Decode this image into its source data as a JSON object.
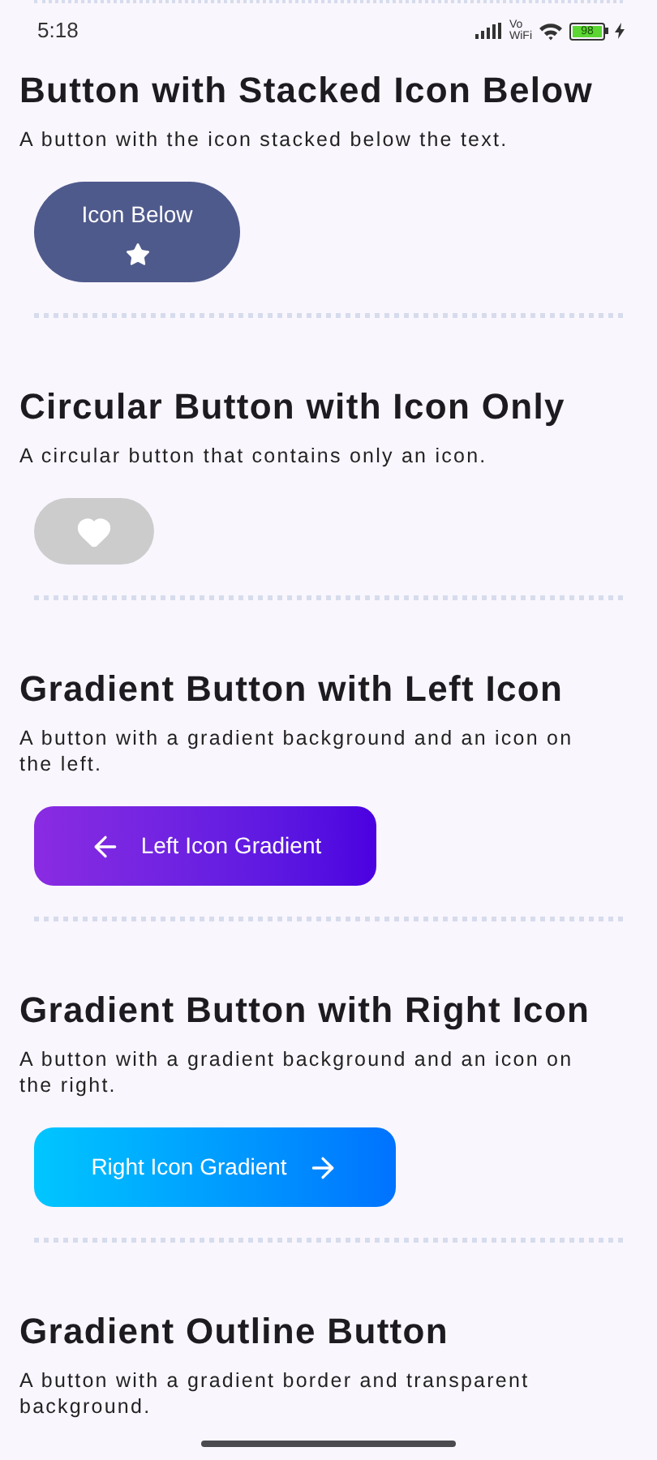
{
  "status_bar": {
    "time": "5:18",
    "vowifi_top": "Vo",
    "vowifi_bottom": "WiFi",
    "battery": "98"
  },
  "sections": [
    {
      "kind": "stacked",
      "title": "Button with Stacked Icon Below",
      "description": "A button with the icon stacked below the text.",
      "button": {
        "label": "Icon Below"
      }
    },
    {
      "kind": "icon_only",
      "title": "Circular Button with Icon Only",
      "description": "A circular button that contains only an icon.",
      "button": {
        "disabled": true
      }
    },
    {
      "kind": "gradient_left",
      "title": "Gradient Button with Left Icon",
      "description": "A button with a gradient background and an icon on the left.",
      "button": {
        "label": "Left Icon Gradient"
      }
    },
    {
      "kind": "gradient_right",
      "title": "Gradient Button with Right Icon",
      "description": "A button with a gradient background and an icon on the right.",
      "button": {
        "label": "Right Icon Gradient"
      }
    },
    {
      "kind": "outline",
      "title": "Gradient Outline Button",
      "description": "A button with a gradient border and transparent background."
    }
  ]
}
